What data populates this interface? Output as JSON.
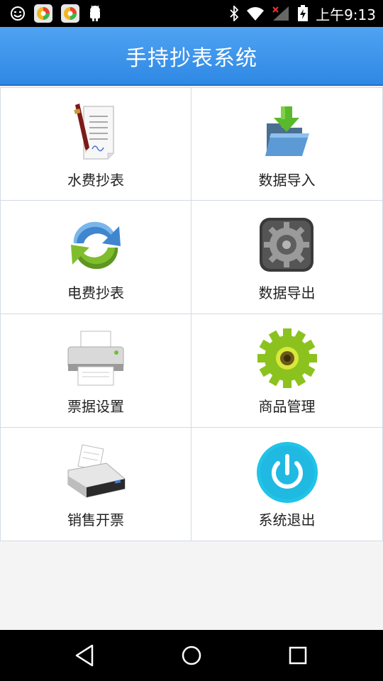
{
  "status_bar": {
    "time": "上午9:13",
    "left_icons": [
      "emoji-icon",
      "app-360-icon",
      "app-360-icon",
      "android-icon"
    ],
    "right_icons": [
      "bluetooth-icon",
      "wifi-icon",
      "signal-icon",
      "battery-charging-icon"
    ]
  },
  "header": {
    "title": "手持抄表系统"
  },
  "menu": [
    {
      "label": "水费抄表",
      "icon": "notepad-pen-icon"
    },
    {
      "label": "数据导入",
      "icon": "folder-import-icon"
    },
    {
      "label": "电费抄表",
      "icon": "refresh-icon"
    },
    {
      "label": "数据导出",
      "icon": "gear-box-icon"
    },
    {
      "label": "票据设置",
      "icon": "printer-icon"
    },
    {
      "label": "商品管理",
      "icon": "gear-icon"
    },
    {
      "label": "销售开票",
      "icon": "printer-paper-icon"
    },
    {
      "label": "系统退出",
      "icon": "power-icon"
    }
  ],
  "nav_bar": {
    "buttons": [
      "back-icon",
      "home-icon",
      "recents-icon"
    ]
  },
  "colors": {
    "header_top": "#4fa3f2",
    "header_bottom": "#2e88e4",
    "border": "#d3dbe3"
  }
}
